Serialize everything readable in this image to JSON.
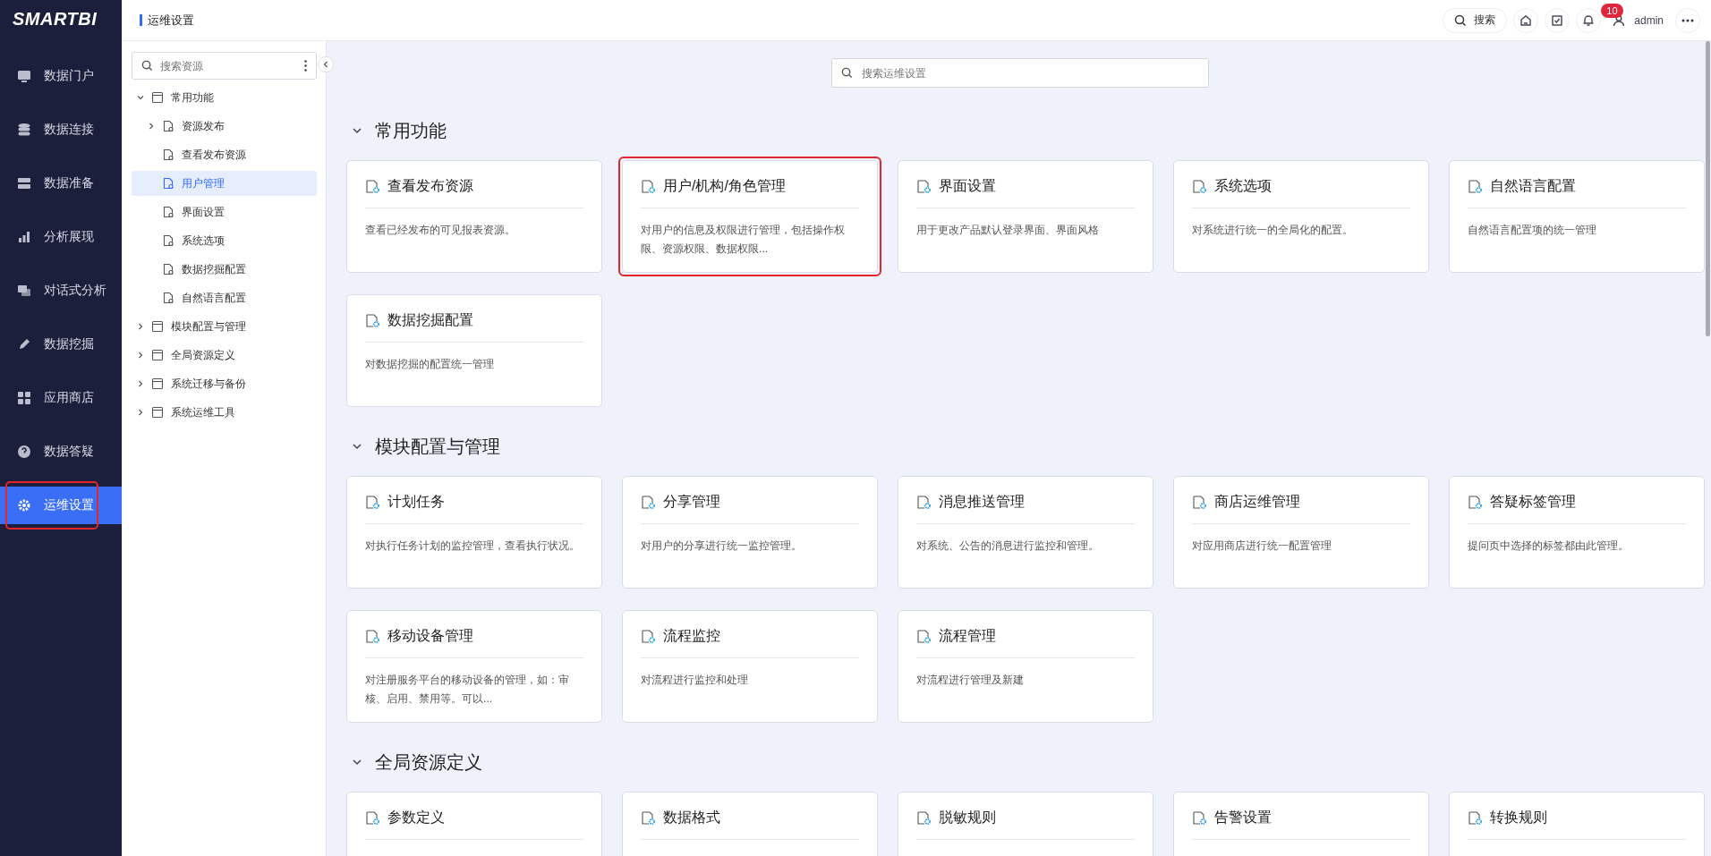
{
  "logo": "SMARTBI",
  "nav": {
    "items": [
      {
        "label": "数据门户",
        "selected": false,
        "highlighted": false
      },
      {
        "label": "数据连接",
        "selected": false,
        "highlighted": false
      },
      {
        "label": "数据准备",
        "selected": false,
        "highlighted": false
      },
      {
        "label": "分析展现",
        "selected": false,
        "highlighted": false
      },
      {
        "label": "对话式分析",
        "selected": false,
        "highlighted": false
      },
      {
        "label": "数据挖掘",
        "selected": false,
        "highlighted": false
      },
      {
        "label": "应用商店",
        "selected": false,
        "highlighted": false
      },
      {
        "label": "数据答疑",
        "selected": false,
        "highlighted": false
      },
      {
        "label": "运维设置",
        "selected": true,
        "highlighted": true
      }
    ]
  },
  "header": {
    "title": "运维设置",
    "search_label": "搜索",
    "notifications": "10",
    "user": "admin"
  },
  "tree": {
    "search": {
      "placeholder": "搜索资源"
    },
    "items": [
      {
        "label": "常用功能",
        "selected": false,
        "expanded": true,
        "children": [
          {
            "label": "资源发布",
            "selected": false,
            "expanded": false
          },
          {
            "label": "查看发布资源",
            "selected": false
          },
          {
            "label": "用户管理",
            "selected": true
          },
          {
            "label": "界面设置",
            "selected": false
          },
          {
            "label": "系统选项",
            "selected": false
          },
          {
            "label": "数据挖掘配置",
            "selected": false
          },
          {
            "label": "自然语言配置",
            "selected": false
          }
        ]
      },
      {
        "label": "模块配置与管理",
        "selected": false,
        "expanded": false
      },
      {
        "label": "全局资源定义",
        "selected": false,
        "expanded": false
      },
      {
        "label": "系统迁移与备份",
        "selected": false,
        "expanded": false
      },
      {
        "label": "系统运维工具",
        "selected": false,
        "expanded": false
      }
    ]
  },
  "main_search": {
    "placeholder": "搜索运维设置"
  },
  "sections": [
    {
      "title": "常用功能",
      "expanded": true,
      "cards": [
        {
          "title": "查看发布资源",
          "description": "查看已经发布的可见报表资源。",
          "highlighted": false
        },
        {
          "title": "用户/机构/角色管理",
          "description": "对用户的信息及权限进行管理，包括操作权限、资源权限、数据权限...",
          "highlighted": true
        },
        {
          "title": "界面设置",
          "description": "用于更改产品默认登录界面、界面风格",
          "highlighted": false
        },
        {
          "title": "系统选项",
          "description": "对系统进行统一的全局化的配置。",
          "highlighted": false
        },
        {
          "title": "自然语言配置",
          "description": "自然语言配置项的统一管理",
          "highlighted": false
        },
        {
          "title": "数据挖掘配置",
          "description": "对数据挖掘的配置统一管理",
          "highlighted": false
        }
      ]
    },
    {
      "title": "模块配置与管理",
      "expanded": true,
      "cards": [
        {
          "title": "计划任务",
          "description": "对执行任务计划的监控管理，查看执行状况。",
          "highlighted": false
        },
        {
          "title": "分享管理",
          "description": "对用户的分享进行统一监控管理。",
          "highlighted": false
        },
        {
          "title": "消息推送管理",
          "description": "对系统、公告的消息进行监控和管理。",
          "highlighted": false
        },
        {
          "title": "商店运维管理",
          "description": "对应用商店进行统一配置管理",
          "highlighted": false
        },
        {
          "title": "答疑标签管理",
          "description": "提问页中选择的标签都由此管理。",
          "highlighted": false
        },
        {
          "title": "移动设备管理",
          "description": "对注册服务平台的移动设备的管理，如：审核、启用、禁用等。可以...",
          "highlighted": false
        },
        {
          "title": "流程监控",
          "description": "对流程进行监控和处理",
          "highlighted": false
        },
        {
          "title": "流程管理",
          "description": "对流程进行管理及新建",
          "highlighted": false
        }
      ]
    },
    {
      "title": "全局资源定义",
      "expanded": true,
      "cards": [
        {
          "title": "参数定义",
          "highlighted": false
        },
        {
          "title": "数据格式",
          "highlighted": false
        },
        {
          "title": "脱敏规则",
          "highlighted": false
        },
        {
          "title": "告警设置",
          "highlighted": false
        },
        {
          "title": "转换规则",
          "highlighted": false
        }
      ]
    }
  ]
}
